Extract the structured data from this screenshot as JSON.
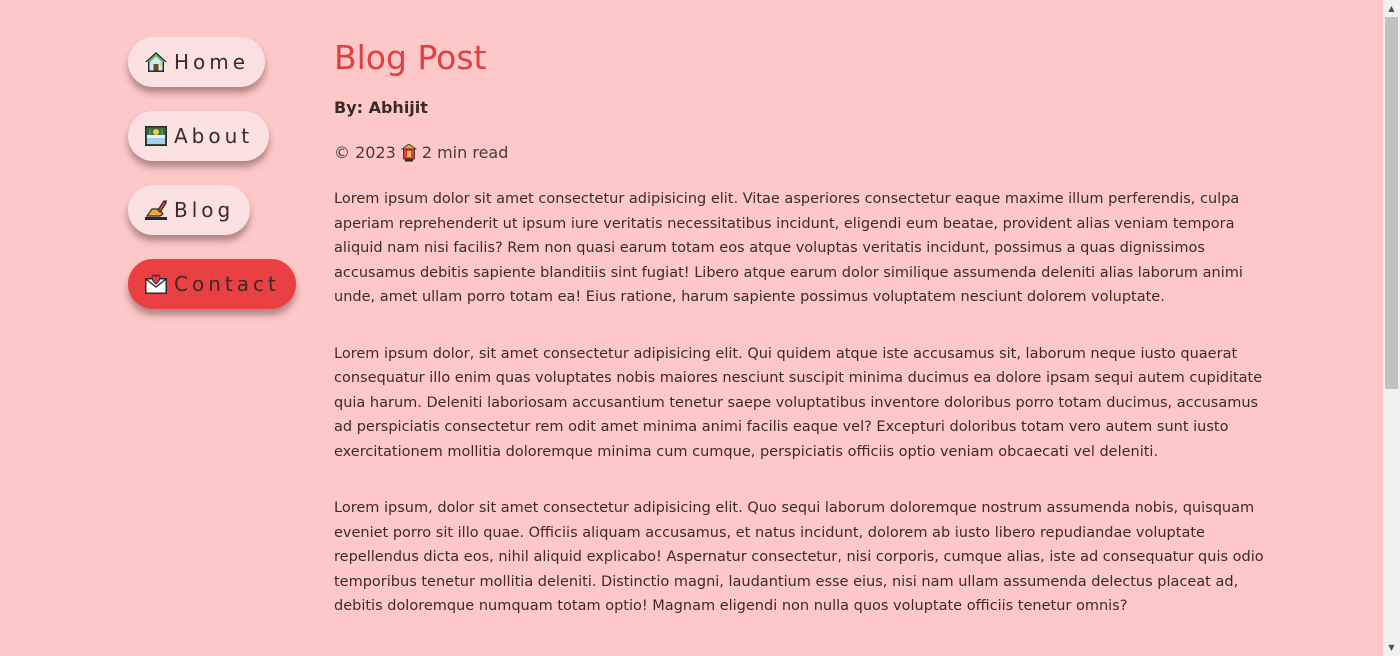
{
  "nav": {
    "items": [
      {
        "label": "Home",
        "icon": "house-icon"
      },
      {
        "label": "About",
        "icon": "picture-icon"
      },
      {
        "label": "Blog",
        "icon": "writing-hand-icon"
      },
      {
        "label": "Contact",
        "icon": "love-letter-icon",
        "active": true
      }
    ]
  },
  "post": {
    "title": "Blog Post",
    "author": "By: Abhijit",
    "meta_year": "© 2023",
    "meta_icon": "lantern-icon",
    "meta_read": "2 min read",
    "paragraphs": [
      "Lorem ipsum dolor sit amet consectetur adipisicing elit. Vitae asperiores consectetur eaque maxime illum perferendis, culpa aperiam reprehenderit ut ipsum iure veritatis necessitatibus incidunt, eligendi eum beatae, provident alias veniam tempora aliquid nam nisi facilis? Rem non quasi earum totam eos atque voluptas veritatis incidunt, possimus a quas dignissimos accusamus debitis sapiente blanditiis sint fugiat! Libero atque earum dolor similique assumenda deleniti alias laborum animi unde, amet ullam porro totam ea! Eius ratione, harum sapiente possimus voluptatem nesciunt dolorem voluptate.",
      "Lorem ipsum dolor, sit amet consectetur adipisicing elit. Qui quidem atque iste accusamus sit, laborum neque iusto quaerat consequatur illo enim quas voluptates nobis maiores nesciunt suscipit minima ducimus ea dolore ipsam sequi autem cupiditate quia harum. Deleniti laboriosam accusantium tenetur saepe voluptatibus inventore doloribus porro totam ducimus, accusamus ad perspiciatis consectetur rem odit amet minima animi facilis eaque vel? Excepturi doloribus totam vero autem sunt iusto exercitationem mollitia doloremque minima cum cumque, perspiciatis officiis optio veniam obcaecati vel deleniti.",
      "Lorem ipsum, dolor sit amet consectetur adipisicing elit. Quo sequi laborum doloremque nostrum assumenda nobis, quisquam eveniet porro sit illo quae. Officiis aliquam accusamus, et natus incidunt, dolorem ab iusto libero repudiandae voluptate repellendus dicta eos, nihil aliquid explicabo! Aspernatur consectetur, nisi corporis, cumque alias, iste ad consequatur quis odio temporibus tenetur mollitia deleniti. Distinctio magni, laudantium esse eius, nisi nam ullam assumenda delectus placeat ad, debitis doloremque numquam totam optio! Magnam eligendi non nulla quos voluptate officiis tenetur omnis?"
    ]
  },
  "colors": {
    "background": "#fec8c8",
    "accent": "#ea3f43",
    "title": "#e33d41",
    "button": "#fbe1e1"
  }
}
